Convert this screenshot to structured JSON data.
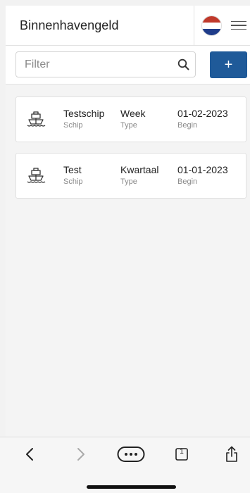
{
  "header": {
    "title": "Binnenhavengeld"
  },
  "filter": {
    "placeholder": "Filter",
    "value": ""
  },
  "add_button": {
    "label": "+"
  },
  "items": [
    {
      "ship": "Testschip",
      "ship_label": "Schip",
      "type": "Week",
      "type_label": "Type",
      "begin": "01-02-2023",
      "begin_label": "Begin"
    },
    {
      "ship": "Test",
      "ship_label": "Schip",
      "type": "Kwartaal",
      "type_label": "Type",
      "begin": "01-01-2023",
      "begin_label": "Begin"
    }
  ],
  "browser": {
    "tabs_count": "1"
  },
  "colors": {
    "accent": "#1f5a99",
    "flag_red": "#c0392b",
    "flag_white": "#ffffff",
    "flag_blue": "#1f3c8a"
  }
}
